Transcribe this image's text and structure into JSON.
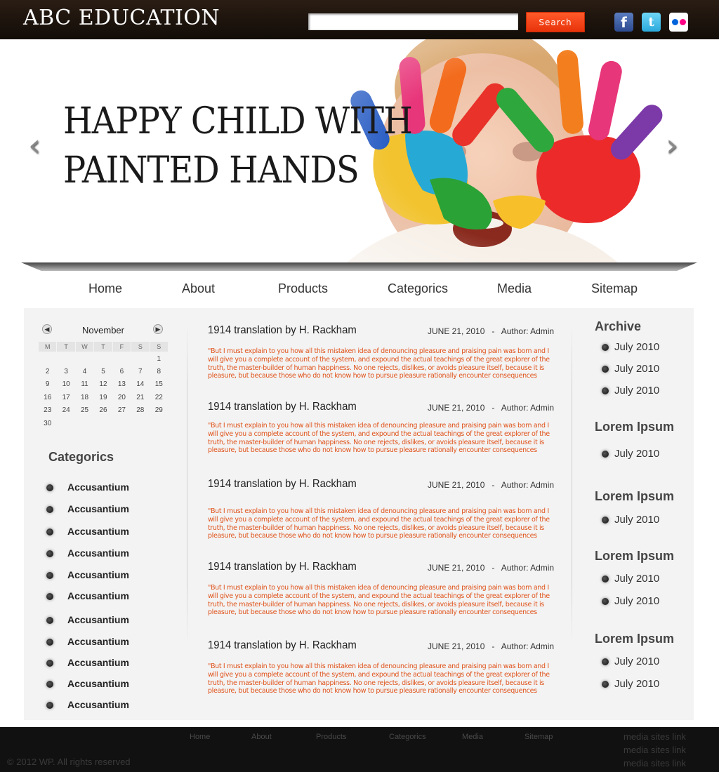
{
  "header": {
    "logo": "ABC EDUCATION",
    "search_placeholder": "",
    "search_label": "Search",
    "social": [
      "facebook-icon",
      "twitter-icon",
      "flickr-icon"
    ]
  },
  "hero": {
    "title_line1": "HAPPY CHILD WITH",
    "title_line2": "PAINTED HANDS",
    "prev": "‹",
    "next": "›"
  },
  "nav": [
    "Home",
    "About",
    "Products",
    "Categorics",
    "Media",
    "Sitemap"
  ],
  "calendar": {
    "month": "November",
    "weekdays": [
      "M",
      "T",
      "W",
      "T",
      "F",
      "S",
      "S"
    ],
    "weeks": [
      [
        "",
        "",
        "",
        "",
        "",
        "",
        "1"
      ],
      [
        "2",
        "3",
        "4",
        "5",
        "6",
        "7",
        "8"
      ],
      [
        "9",
        "10",
        "11",
        "12",
        "13",
        "14",
        "15"
      ],
      [
        "16",
        "17",
        "18",
        "19",
        "20",
        "21",
        "22"
      ],
      [
        "23",
        "24",
        "25",
        "26",
        "27",
        "28",
        "29"
      ],
      [
        "30",
        "",
        "",
        "",
        "",
        "",
        ""
      ]
    ]
  },
  "categories": {
    "title": "Categorics",
    "items": [
      "Accusantium",
      "Accusantium",
      "Accusantium",
      "Accusantium",
      "Accusantium",
      "Accusantium",
      "Accusantium",
      "Accusantium",
      "Accusantium",
      "Accusantium",
      "Accusantium"
    ]
  },
  "posts": [
    {
      "title": "1914 translation by H. Rackham",
      "meta": "JUNE 21, 2010   -   Author: Admin",
      "body": "\"But I must explain to you how all this mistaken idea of denouncing pleasure and praising pain was born and I will give you a complete account of the system, and expound the actual teachings of the great explorer of the truth, the master-builder of human happiness. No one rejects, dislikes, or avoids pleasure itself, because it is pleasure, but because those who do not know how to pursue pleasure rationally encounter consequences"
    },
    {
      "title": "1914 translation by H. Rackham",
      "meta": "JUNE 21, 2010   -   Author: Admin",
      "body": "\"But I must explain to you how all this mistaken idea of denouncing pleasure and praising pain was born and I will give you a complete account of the system, and expound the actual teachings of the great explorer of the truth, the master-builder of human happiness. No one rejects, dislikes, or avoids pleasure itself, because it is pleasure, but because those who do not know how to pursue pleasure rationally encounter consequences"
    },
    {
      "title": "1914 translation by H. Rackham",
      "meta": "JUNE 21, 2010   -   Author: Admin",
      "body": "\"But I must explain to you how all this mistaken idea of denouncing pleasure and praising pain was born and I will give you a complete account of the system, and expound the actual teachings of the great explorer of the truth, the master-builder of human happiness. No one rejects, dislikes, or avoids pleasure itself, because it is pleasure, but because those who do not know how to pursue pleasure rationally encounter consequences"
    },
    {
      "title": "1914 translation by H. Rackham",
      "meta": "JUNE 21, 2010   -   Author: Admin",
      "body": "\"But I must explain to you how all this mistaken idea of denouncing pleasure and praising pain was born and I will give you a complete account of the system, and expound the actual teachings of the great explorer of the truth, the master-builder of human happiness. No one rejects, dislikes, or avoids pleasure itself, because it is pleasure, but because those who do not know how to pursue pleasure rationally encounter consequences"
    },
    {
      "title": "1914 translation by H. Rackham",
      "meta": "JUNE 21, 2010   -   Author: Admin",
      "body": "\"But I must explain to you how all this mistaken idea of denouncing pleasure and praising pain was born and I will give you a complete account of the system, and expound the actual teachings of the great explorer of the truth, the master-builder of human happiness. No one rejects, dislikes, or avoids pleasure itself, because it is pleasure, but because those who do not know how to pursue pleasure rationally encounter consequences"
    }
  ],
  "sidebar": {
    "sections": [
      {
        "heading": "Archive",
        "links": [
          "July 2010",
          "July 2010",
          "July 2010"
        ]
      },
      {
        "heading": "Lorem Ipsum",
        "links": [
          "July 2010"
        ]
      },
      {
        "heading": "Lorem Ipsum",
        "links": [
          "July 2010"
        ]
      },
      {
        "heading": "Lorem Ipsum",
        "links": [
          "July 2010",
          "July 2010"
        ]
      },
      {
        "heading": "Lorem Ipsum",
        "links": [
          "July 2010",
          "July 2010"
        ]
      }
    ]
  },
  "footer": {
    "nav": [
      "Home",
      "About",
      "Products",
      "Categorics",
      "Media",
      "Sitemap"
    ],
    "copyright": "© 2012 WP. All rights reserved",
    "links": [
      "media sites link",
      "media sites link",
      "media sites link"
    ]
  },
  "colors": {
    "header_bg": "#1a120b",
    "accent": "#f04a1a",
    "post_body": "#e0531b",
    "panel_bg": "#f3f3f3",
    "footer_bg": "#111111"
  }
}
